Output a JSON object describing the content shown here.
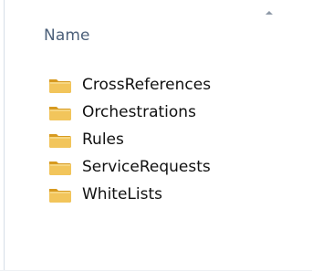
{
  "window": {
    "column_header": "Name",
    "sort_direction_icon": "sort-ascending-icon"
  },
  "folders": [
    {
      "label": "CrossReferences",
      "icon": "folder-icon"
    },
    {
      "label": "Orchestrations",
      "icon": "folder-icon"
    },
    {
      "label": "Rules",
      "icon": "folder-icon"
    },
    {
      "label": "ServiceRequests",
      "icon": "folder-icon"
    },
    {
      "label": "WhiteLists",
      "icon": "folder-icon"
    }
  ],
  "colors": {
    "header_text": "#4c607a",
    "item_text": "#111111",
    "folder_fill": "#f2c55b",
    "folder_dark": "#d79a20"
  }
}
